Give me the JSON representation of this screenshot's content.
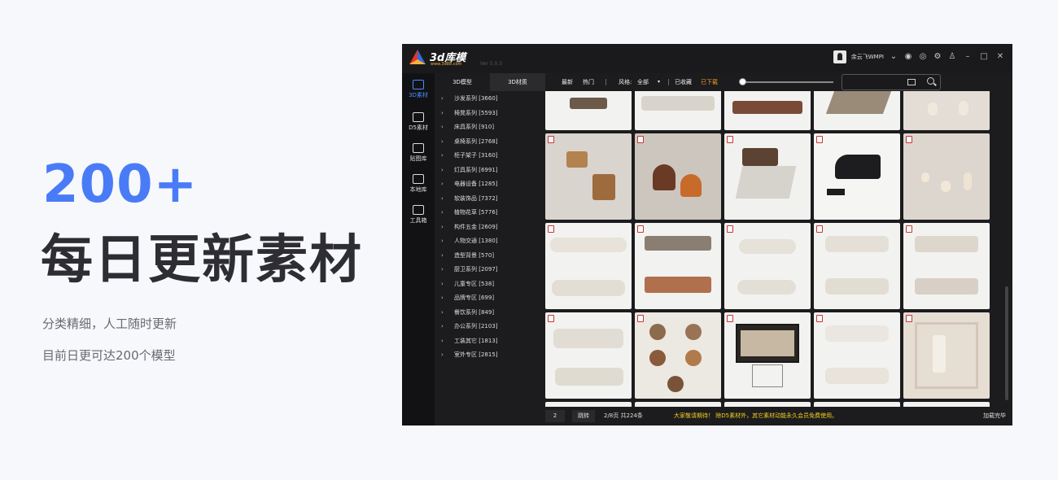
{
  "hero": {
    "number": "200+",
    "title": "每日更新素材",
    "line1": "分类精细，人工随时更新",
    "line2": "目前日更可达200个模型"
  },
  "app": {
    "logo_text": "3d库模",
    "logo_sub": "www.3d88.com",
    "version": "Ver 5.0.3",
    "username": "余云飞WMPI",
    "side_nav": [
      {
        "label": "3D素材",
        "icon": "cube-icon"
      },
      {
        "label": "D5素材",
        "icon": "building-icon"
      },
      {
        "label": "贴图库",
        "icon": "layers-icon"
      },
      {
        "label": "本地库",
        "icon": "monitor-icon"
      },
      {
        "label": "工具箱",
        "icon": "clipboard-icon"
      }
    ],
    "tabs": [
      "3D模型",
      "3D材质"
    ],
    "toolbar": {
      "latest": "最新",
      "hot": "热门",
      "style_label": "风格:",
      "style_value": "全部",
      "collected": "已收藏",
      "downloaded": "已下载"
    },
    "categories": [
      "沙发系列 [3660]",
      "椅凳系列 [5593]",
      "床具系列 [910]",
      "桌椅系列 [2768]",
      "柜子架子 [3160]",
      "灯具系列 [6991]",
      "电器设备 [1285]",
      "软装饰品 [7372]",
      "植物花草 [5776]",
      "构件五金 [2609]",
      "人物交通 [1380]",
      "造型背景 [570]",
      "厨卫系列 [2097]",
      "儿童专区 [538]",
      "品牌专区 [699]",
      "餐饮系列 [849]",
      "办公系列 [2103]",
      "工装其它 [1813]",
      "室外专区 [2815]"
    ],
    "footer": {
      "page_value": "2",
      "jump": "跳转",
      "page_info": "2/8页 共224条",
      "notice": "大家敬请期待！  除D5素材外，其它素材动能永久会员免费使用。",
      "status": "加载完毕"
    },
    "colors": {
      "accent_blue": "#4a7bf7",
      "active_nav": "#4a8cff",
      "downloaded_orange": "#f4a020",
      "notice_yellow": "#f4d020"
    }
  }
}
